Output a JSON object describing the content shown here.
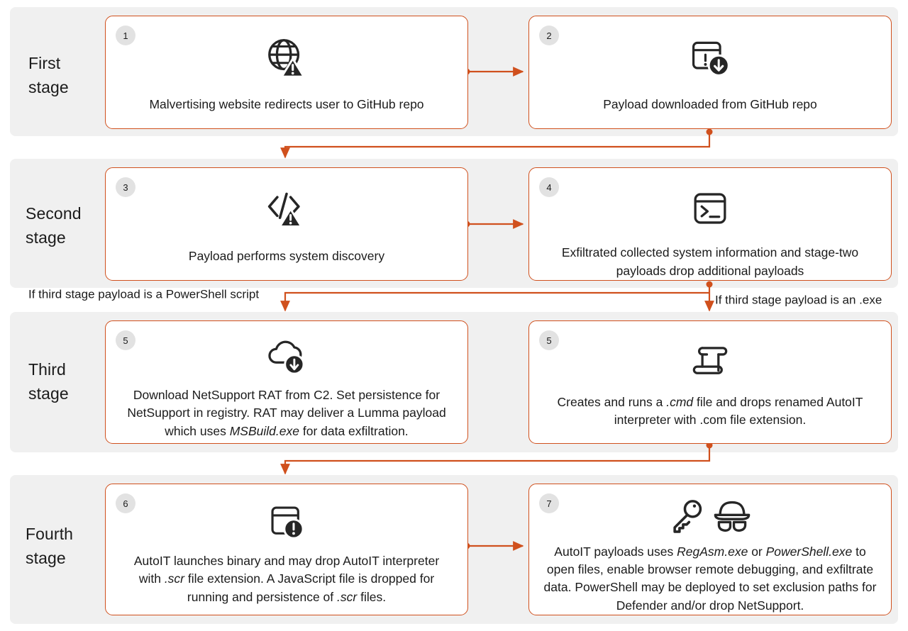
{
  "theme": {
    "accent": "#d0501d",
    "band_bg": "#f0f0f0",
    "card_bg": "#ffffff",
    "badge_bg": "#e2e2e2",
    "text": "#1b1b1b",
    "icon": "#262626"
  },
  "stages": [
    {
      "id": "first-stage",
      "label": "First\nstage",
      "cards": [
        {
          "number": "1",
          "icon": "globe-warning-icon",
          "text": "Malvertising website redirects user to GitHub repo"
        },
        {
          "number": "2",
          "icon": "window-download-warning-icon",
          "text": "Payload downloaded from GitHub repo"
        }
      ]
    },
    {
      "id": "second-stage",
      "label": "Second\nstage",
      "cards": [
        {
          "number": "3",
          "icon": "code-warning-icon",
          "text": "Payload performs system discovery"
        },
        {
          "number": "4",
          "icon": "terminal-icon",
          "text": "Exfiltrated collected system information and stage-two payloads drop additional payloads"
        }
      ]
    },
    {
      "id": "third-stage",
      "label": "Third\nstage",
      "cards": [
        {
          "number": "5",
          "icon": "cloud-download-icon",
          "text_html": "Download NetSupport RAT from C2. Set persistence for NetSupport in registry. RAT may deliver a Lumma payload which uses <em>MSBuild.exe</em> for data exfiltration."
        },
        {
          "number": "5",
          "icon": "script-scroll-icon",
          "text_html": "Creates and runs a <em>.cmd</em> file and drops renamed AutoIT interpreter with .com file extension."
        }
      ]
    },
    {
      "id": "fourth-stage",
      "label": "Fourth\nstage",
      "cards": [
        {
          "number": "6",
          "icon": "window-warning-icon",
          "text_html": "AutoIT launches binary and may drop AutoIT interpreter with <em>.scr</em> file extension. A JavaScript file is dropped for running and persistence of <em>.scr</em> files."
        },
        {
          "number": "7",
          "icon": "key-spy-icon",
          "text_html": "AutoIT payloads uses <em>RegAsm.exe</em> or <em>PowerShell.exe</em> to open files, enable browser remote debugging, and exfiltrate data. PowerShell may be deployed to set exclusion paths for Defender and/or drop NetSupport."
        }
      ]
    }
  ],
  "branch_labels": {
    "left": "If third stage payload is a PowerShell script",
    "right": "If third stage payload is an .exe"
  }
}
